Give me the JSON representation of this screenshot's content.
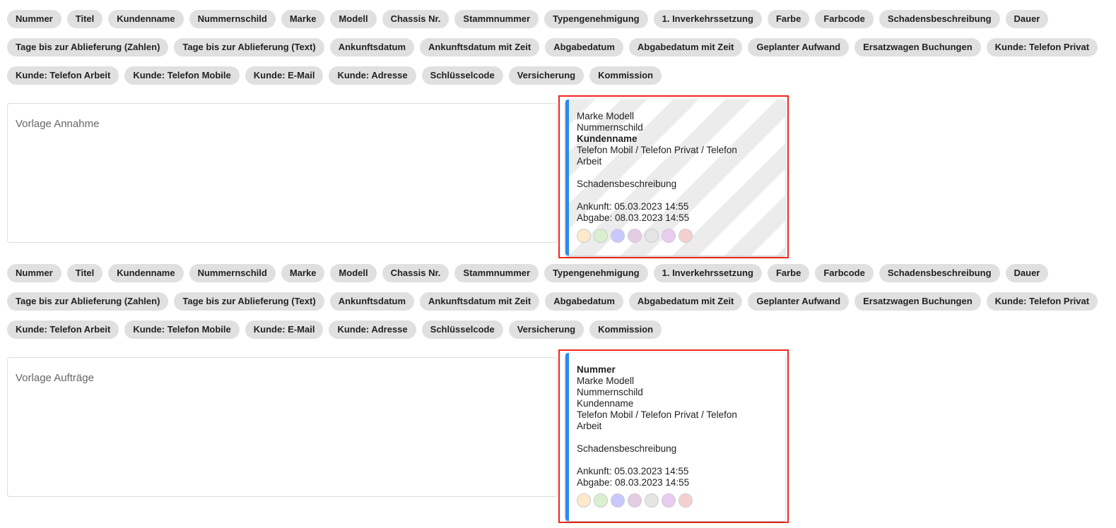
{
  "chips": [
    "Nummer",
    "Titel",
    "Kundenname",
    "Nummernschild",
    "Marke",
    "Modell",
    "Chassis Nr.",
    "Stammnummer",
    "Typengenehmigung",
    "1. Inverkehrssetzung",
    "Farbe",
    "Farbcode",
    "Schadensbeschreibung",
    "Dauer",
    "Tage bis zur Ablieferung (Zahlen)",
    "Tage bis zur Ablieferung (Text)",
    "Ankunftsdatum",
    "Ankunftsdatum mit Zeit",
    "Abgabedatum",
    "Abgabedatum mit Zeit",
    "Geplanter Aufwand",
    "Ersatzwagen Buchungen",
    "Kunde: Telefon Privat",
    "Kunde: Telefon Arbeit",
    "Kunde: Telefon Mobile",
    "Kunde: E-Mail",
    "Kunde: Adresse",
    "Schlüsselcode",
    "Versicherung",
    "Kommission"
  ],
  "sections": [
    {
      "placeholder": "Vorlage Annahme",
      "preview": [
        "Marke Modell",
        "Nummernschild",
        "Kundenname",
        "Telefon Mobil / Telefon Privat / Telefon",
        "Arbeit",
        "",
        "Schadensbeschreibung",
        "",
        "Ankunft: 05.03.2023 14:55",
        "Abgabe: 08.03.2023 14:55"
      ],
      "bold_line": 2
    },
    {
      "placeholder": "Vorlage Aufträge",
      "preview": [
        "Nummer",
        "Marke Modell",
        "Nummernschild",
        "Kundenname",
        "Telefon Mobil / Telefon Privat / Telefon",
        "Arbeit",
        "",
        "Schadensbeschreibung",
        "",
        "Ankunft: 05.03.2023 14:55",
        "Abgabe: 08.03.2023 14:55"
      ],
      "bold_line": 0
    }
  ],
  "colors": {
    "accent": "#2a8af0",
    "highlight": "#f0281e",
    "swatches": [
      "#fde9cc",
      "#d8f0d0",
      "#c8c8fc",
      "#e4cce4",
      "#e4e4e4",
      "#e8ccf0",
      "#f4d0d0"
    ]
  }
}
